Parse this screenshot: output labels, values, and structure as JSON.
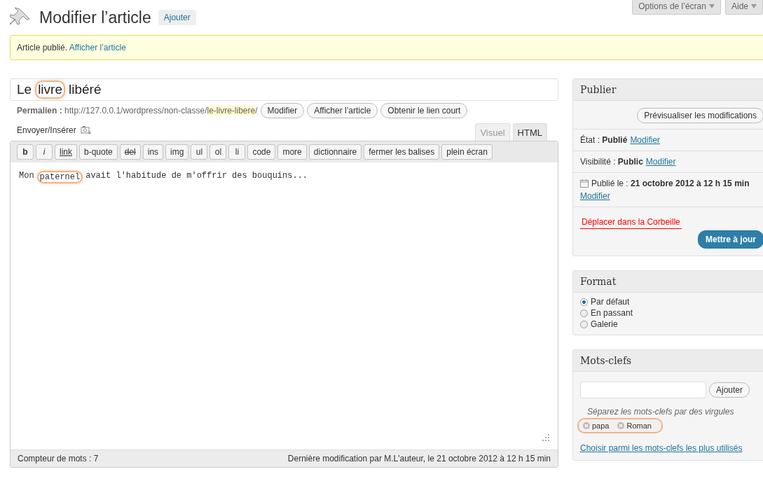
{
  "header": {
    "title": "Modifier l’article",
    "add_button": "Ajouter",
    "screen_options": "Options de l’écran",
    "help": "Aide"
  },
  "notice": {
    "text": "Article publié.",
    "link": "Afficher l’article"
  },
  "post_title": [
    {
      "text": "Le",
      "highlighted": false
    },
    {
      "text": "livre",
      "highlighted": true
    },
    {
      "text": "libéré",
      "highlighted": false
    }
  ],
  "permalink": {
    "label": "Permalien :",
    "base": "http://127.0.0.1/wordpress/non-classe/",
    "slug": "le-livre-libere",
    "trailing": "/",
    "buttons": [
      "Modifier",
      "Afficher l’article",
      "Obtenir le lien court"
    ]
  },
  "media_button": "Envoyer/Insérer",
  "editor_tabs": [
    {
      "label": "Visuel",
      "selected": false
    },
    {
      "label": "HTML",
      "selected": true
    }
  ],
  "quicktags": [
    {
      "label": "b",
      "kind": "bold"
    },
    {
      "label": "i",
      "kind": "italic"
    },
    {
      "label": "link",
      "kind": "underline"
    },
    {
      "label": "b-quote",
      "kind": "plain"
    },
    {
      "label": "del",
      "kind": "strike"
    },
    {
      "label": "ins",
      "kind": "plain"
    },
    {
      "label": "img",
      "kind": "plain"
    },
    {
      "label": "ul",
      "kind": "plain"
    },
    {
      "label": "ol",
      "kind": "plain"
    },
    {
      "label": "li",
      "kind": "plain"
    },
    {
      "label": "code",
      "kind": "plain"
    },
    {
      "label": "more",
      "kind": "plain"
    },
    {
      "label": "dictionnaire",
      "kind": "plain"
    },
    {
      "label": "fermer les balises",
      "kind": "plain"
    },
    {
      "label": "plein écran",
      "kind": "plain"
    }
  ],
  "content": [
    {
      "text": "Mon",
      "highlighted": false
    },
    {
      "text": "paternel",
      "highlighted": true
    },
    {
      "text": "avait l'habitude de m'offrir des bouquins...",
      "highlighted": false
    }
  ],
  "status": {
    "word_count": "Compteur de mots : 7",
    "last_edit": "Dernière modification par M.L'auteur, le 21 octobre 2012 à 12 h 15 min"
  },
  "publish_box": {
    "title": "Publier",
    "preview": "Prévisualiser les modifications",
    "rows": [
      {
        "label": "État :",
        "value": "Publié",
        "link": "Modifier",
        "icon": false
      },
      {
        "label": "Visibilité :",
        "value": "Public",
        "link": "Modifier",
        "icon": false
      },
      {
        "label": "Publié le :",
        "value": "21 octobre 2012 à 12 h 15 min",
        "link": "Modifier",
        "icon": true
      }
    ],
    "trash": "Déplacer dans la Corbeille",
    "update": "Mettre à jour"
  },
  "format_box": {
    "title": "Format",
    "options": [
      {
        "label": "Par défaut",
        "selected": true
      },
      {
        "label": "En passant",
        "selected": false
      },
      {
        "label": "Galerie",
        "selected": false
      }
    ]
  },
  "tags_box": {
    "title": "Mots-clefs",
    "add": "Ajouter",
    "hint": "Séparez les mots-clefs par des virgules",
    "tags_highlighted": true,
    "tags": [
      "papa",
      "Roman"
    ],
    "most_used": "Choisir parmi les mots-clefs les plus utilisés"
  }
}
